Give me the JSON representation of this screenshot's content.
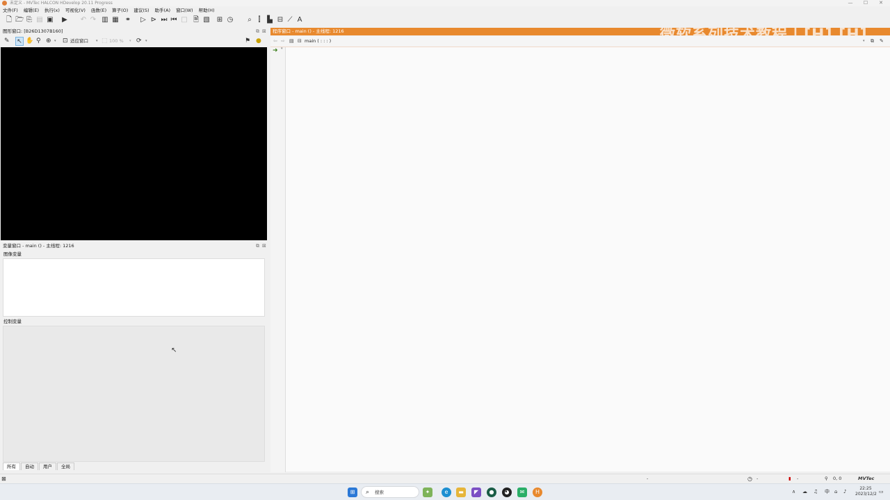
{
  "window": {
    "title": "未定义 - MVTec HALCON HDevelop 20.11 Progress",
    "minimize": "—",
    "maximize": "☐",
    "close": "✕"
  },
  "menu": [
    "文件(F)",
    "编辑(E)",
    "执行(x)",
    "可视化(V)",
    "函数(E)",
    "算子(O)",
    "建议(S)",
    "助手(A)",
    "窗口(W)",
    "帮助(H)"
  ],
  "graphics_window": {
    "title": "图形窗口: [B26D1307B160]",
    "fit_window_label": "适应窗口",
    "zoom_value": "100 %"
  },
  "variable_window": {
    "title": "变量窗口 - main () - 主线程: 1216",
    "iconic_label": "图像变量",
    "control_label": "控制变量",
    "tabs": [
      "所有",
      "自动",
      "用户",
      "全局"
    ]
  },
  "program_window": {
    "title": "程序窗口 - main () - 主线程: 1216",
    "watermark": "微软系列技术教程丨[H] [H]",
    "procedure": "main ( : : : )"
  },
  "status": {
    "dash1": "-",
    "dash2": "-",
    "dash3": "-",
    "coords": "0, 0",
    "brand": "MVTec"
  },
  "taskbar": {
    "search_placeholder": "搜索",
    "ime": "中",
    "time": "22:25",
    "date": "2023/12/2"
  },
  "colors": {
    "accent_orange": "#e8892e",
    "canvas_black": "#000000",
    "run_arrow_green": "#3a7d1a"
  }
}
